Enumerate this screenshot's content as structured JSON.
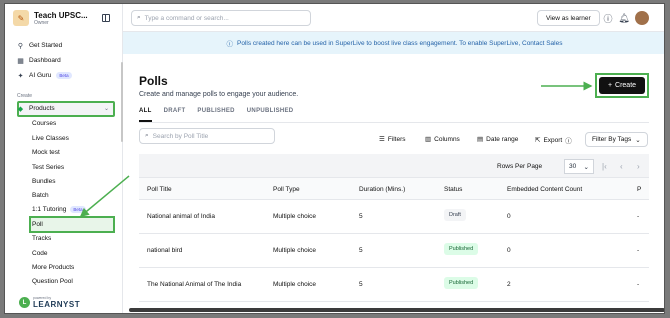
{
  "sidebar": {
    "brand": {
      "name": "Teach UPSC...",
      "role": "Owner"
    },
    "top_items": [
      {
        "label": "Get Started",
        "icon": "rocket-icon"
      },
      {
        "label": "Dashboard",
        "icon": "dashboard-icon"
      },
      {
        "label": "AI Guru",
        "icon": "sparkle-icon",
        "badge": "Beta"
      }
    ],
    "section_label": "Create",
    "products": {
      "label": "Products",
      "icon": "box-icon"
    },
    "sub_items": [
      {
        "label": "Courses"
      },
      {
        "label": "Live Classes"
      },
      {
        "label": "Mock test"
      },
      {
        "label": "Test Series"
      },
      {
        "label": "Bundles"
      },
      {
        "label": "Batch"
      },
      {
        "label": "1:1 Tutoring",
        "badge": "Beta"
      },
      {
        "label": "Poll"
      },
      {
        "label": "Tracks"
      },
      {
        "label": "Code"
      },
      {
        "label": "More Products"
      },
      {
        "label": "Question Pool"
      }
    ],
    "footer": {
      "powered_by": "powered by",
      "name": "LEARNYST"
    }
  },
  "topbar": {
    "command_placeholder": "Type a command or search...",
    "view_as_learner": "View as learner",
    "help_icon": "help-icon",
    "bell_icon": "bell-icon"
  },
  "banner": {
    "text": "Polls created here can be used in SuperLive to boost live class engagement. To enable SuperLive, Contact Sales",
    "color": "#e6f4fb"
  },
  "main": {
    "title": "Polls",
    "subtitle": "Create and manage polls to engage your audience.",
    "create_label": "Create",
    "tabs": [
      "ALL",
      "DRAFT",
      "PUBLISHED",
      "UNPUBLISHED"
    ],
    "search_placeholder": "Search by Poll Title",
    "toolbar": {
      "filters": "Filters",
      "columns": "Columns",
      "date_range": "Date range",
      "export": "Export",
      "filter_by_tags": "Filter By Tags"
    },
    "pagination": {
      "rows_per_page_label": "Rows Per Page",
      "rows_per_page": "30"
    },
    "table": {
      "columns": [
        "Poll Title",
        "Poll Type",
        "Duration (Mins.)",
        "Status",
        "Embedded Content Count",
        "P"
      ],
      "rows": [
        {
          "title": "National animal of India",
          "type": "Multiple choice",
          "duration": "5",
          "status": "Draft",
          "count": "0",
          "extra": "-"
        },
        {
          "title": "national bird",
          "type": "Multiple choice",
          "duration": "5",
          "status": "Published",
          "count": "0",
          "extra": "-"
        },
        {
          "title": "The National Animal of The India",
          "type": "Multiple choice",
          "duration": "5",
          "status": "Published",
          "count": "2",
          "extra": "-"
        }
      ]
    }
  },
  "colors": {
    "highlight": "#4caf50",
    "create_button": "#111111"
  }
}
